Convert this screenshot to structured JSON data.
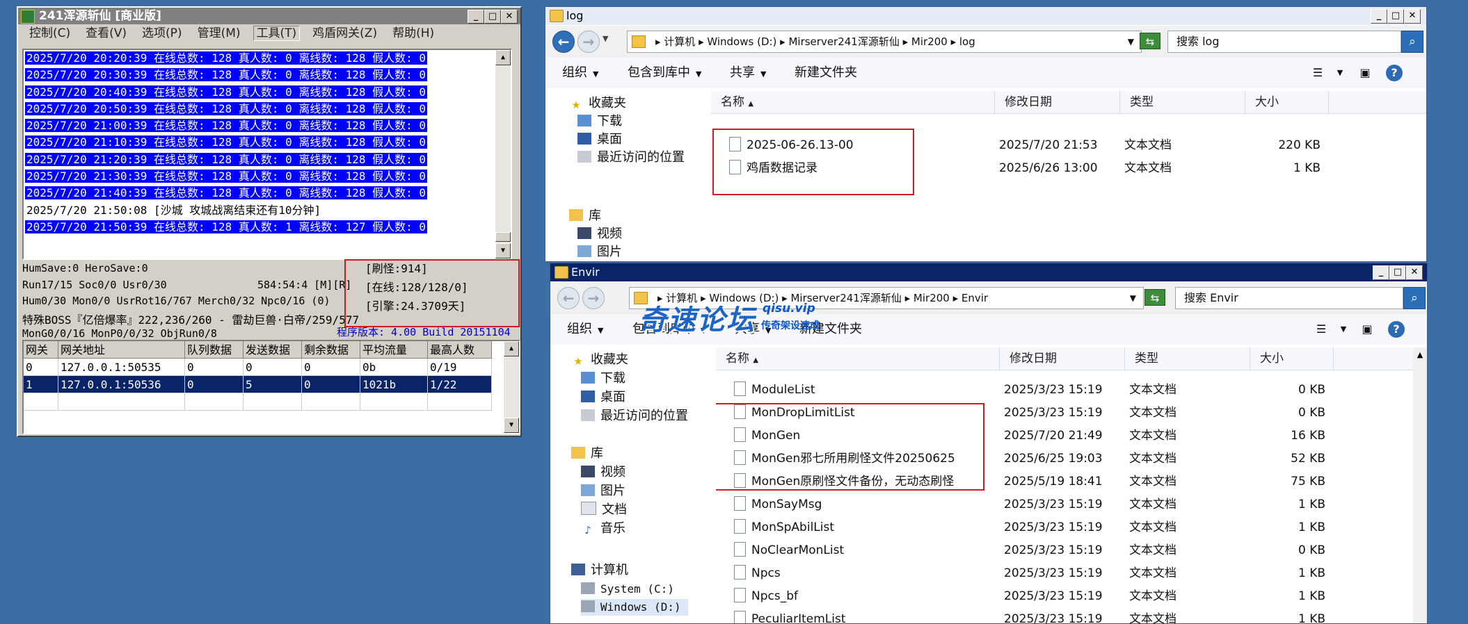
{
  "server_window": {
    "title": "241浑源斩仙 [商业版]",
    "menu": [
      "控制(C)",
      "查看(V)",
      "选项(P)",
      "管理(M)",
      "工具(T)",
      "鸡盾网关(Z)",
      "帮助(H)"
    ],
    "log_lines": [
      {
        "text": "2025/7/20 20:20:39 在线总数: 128 真人数: 0 离线数: 128 假人数: 0",
        "selected": true
      },
      {
        "text": "2025/7/20 20:30:39 在线总数: 128 真人数: 0 离线数: 128 假人数: 0",
        "selected": true
      },
      {
        "text": "2025/7/20 20:40:39 在线总数: 128 真人数: 0 离线数: 128 假人数: 0",
        "selected": true
      },
      {
        "text": "2025/7/20 20:50:39 在线总数: 128 真人数: 0 离线数: 128 假人数: 0",
        "selected": true
      },
      {
        "text": "2025/7/20 21:00:39 在线总数: 128 真人数: 0 离线数: 128 假人数: 0",
        "selected": true
      },
      {
        "text": "2025/7/20 21:10:39 在线总数: 128 真人数: 0 离线数: 128 假人数: 0",
        "selected": true
      },
      {
        "text": "2025/7/20 21:20:39 在线总数: 128 真人数: 0 离线数: 128 假人数: 0",
        "selected": true
      },
      {
        "text": "2025/7/20 21:30:39 在线总数: 128 真人数: 0 离线数: 128 假人数: 0",
        "selected": true
      },
      {
        "text": "2025/7/20 21:40:39 在线总数: 128 真人数: 0 离线数: 128 假人数: 0",
        "selected": true
      },
      {
        "text": "2025/7/20 21:50:08 [沙城 攻城战离结束还有10分钟]",
        "selected": false
      },
      {
        "text": "2025/7/20 21:50:39 在线总数: 128 真人数: 1 离线数: 127 假人数: 0",
        "selected": true
      }
    ],
    "status": {
      "line1": "HumSave:0 HeroSave:0",
      "line2": "Run17/15 Soc0/0 Usr0/30",
      "line2b": "584:54:4 [M][R]",
      "line3": "Hum0/30 Mon0/0 UsrRot16/767 Merch0/32 Npc0/16 (0)",
      "line4": "特殊BOSS『亿倍爆率』222,236/260 - 雷劫巨兽·白帝/259/577",
      "line5": "MonG0/0/16 MonP0/0/32 ObjRun0/8",
      "version": "程序版本: 4.00 Build 20151104",
      "counter_refresh": "[刷怪:914]",
      "counter_online": "[在线:128/128/0]",
      "counter_engine": "[引擎:24.3709天]"
    },
    "gateway_table": {
      "headers": [
        "网关",
        "网关地址",
        "队列数据",
        "发送数据",
        "剩余数据",
        "平均流量",
        "最高人数"
      ],
      "rows": [
        [
          "0",
          "127.0.0.1:50535",
          "0",
          "0",
          "0",
          "0b",
          "0/19"
        ],
        [
          "1",
          "127.0.0.1:50536",
          "0",
          "5",
          "0",
          "1021b",
          "1/22"
        ]
      ]
    }
  },
  "log_window": {
    "title": "log",
    "breadcrumb": "▸ 计算机 ▸ Windows (D:) ▸ Mirserver241浑源斩仙 ▸ Mir200 ▸ log",
    "search_placeholder": "搜索 log",
    "toolbar": {
      "organize": "组织",
      "include": "包含到库中",
      "share": "共享",
      "new_folder": "新建文件夹"
    },
    "nav": {
      "favorites": "收藏夹",
      "downloads": "下载",
      "desktop": "桌面",
      "recent": "最近访问的位置",
      "libraries": "库",
      "videos": "视频",
      "pictures": "图片"
    },
    "columns": {
      "name": "名称",
      "date": "修改日期",
      "type": "类型",
      "size": "大小"
    },
    "files": [
      {
        "name": "2025-06-26.13-00",
        "date": "2025/7/20 21:53",
        "type": "文本文档",
        "size": "220 KB"
      },
      {
        "name": "鸡盾数据记录",
        "date": "2025/6/26 13:00",
        "type": "文本文档",
        "size": "1 KB"
      }
    ]
  },
  "envir_window": {
    "title": "Envir",
    "breadcrumb": "▸ 计算机 ▸ Windows (D:) ▸ Mirserver241浑源斩仙 ▸ Mir200 ▸ Envir",
    "search_placeholder": "搜索 Envir",
    "toolbar": {
      "organize": "组织",
      "include": "包含到库中",
      "share": "共享",
      "new_folder": "新建文件夹"
    },
    "nav": {
      "favorites": "收藏夹",
      "downloads": "下载",
      "desktop": "桌面",
      "recent": "最近访问的位置",
      "libraries": "库",
      "videos": "视频",
      "pictures": "图片",
      "documents": "文档",
      "music": "音乐",
      "computer": "计算机",
      "drive_c": "System (C:)",
      "drive_d": "Windows (D:)"
    },
    "columns": {
      "name": "名称",
      "date": "修改日期",
      "type": "类型",
      "size": "大小"
    },
    "files": [
      {
        "name": "ModuleList",
        "date": "2025/3/23 15:19",
        "type": "文本文档",
        "size": "0 KB"
      },
      {
        "name": "MonDropLimitList",
        "date": "2025/3/23 15:19",
        "type": "文本文档",
        "size": "0 KB"
      },
      {
        "name": "MonGen",
        "date": "2025/7/20 21:49",
        "type": "文本文档",
        "size": "16 KB"
      },
      {
        "name": "MonGen邪七所用刷怪文件20250625",
        "date": "2025/6/25 19:03",
        "type": "文本文档",
        "size": "52 KB"
      },
      {
        "name": "MonGen原刷怪文件备份，无动态刷怪",
        "date": "2025/5/19 18:41",
        "type": "文本文档",
        "size": "75 KB"
      },
      {
        "name": "MonSayMsg",
        "date": "2025/3/23 15:19",
        "type": "文本文档",
        "size": "1 KB"
      },
      {
        "name": "MonSpAbilList",
        "date": "2025/3/23 15:19",
        "type": "文本文档",
        "size": "1 KB"
      },
      {
        "name": "NoClearMonList",
        "date": "2025/3/23 15:19",
        "type": "文本文档",
        "size": "0 KB"
      },
      {
        "name": "Npcs",
        "date": "2025/3/23 15:19",
        "type": "文本文档",
        "size": "1 KB"
      },
      {
        "name": "Npcs_bf",
        "date": "2025/3/23 15:19",
        "type": "文本文档",
        "size": "1 KB"
      },
      {
        "name": "PeculiarItemList",
        "date": "2025/3/23 15:19",
        "type": "文本文档",
        "size": "1 KB"
      }
    ]
  },
  "watermark": {
    "main": "奇速论坛",
    "url": "qisu.vip",
    "sub": "传奇架设速成"
  }
}
